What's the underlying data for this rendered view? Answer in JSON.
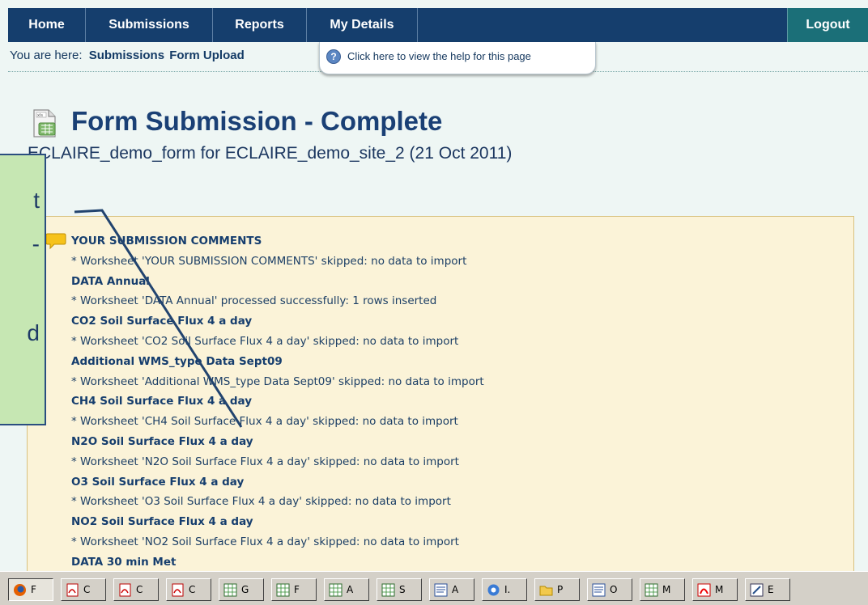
{
  "nav": {
    "items": [
      {
        "label": "Home"
      },
      {
        "label": "Submissions"
      },
      {
        "label": "Reports"
      },
      {
        "label": "My Details"
      }
    ],
    "logout": "Logout"
  },
  "breadcrumb": {
    "prefix": "You are here:",
    "section": "Submissions",
    "page": "Form Upload"
  },
  "help": {
    "icon": "help-icon",
    "text": "Click here to view the help for this page"
  },
  "page": {
    "title_icon": "spreadsheet-file-icon",
    "title": "Form Submission - Complete",
    "subtitle": "ECLAIRE_demo_form for ECLAIRE_demo_site_2 (21 Oct 2011)"
  },
  "comments": {
    "icon": "comment-bubble-icon",
    "entries": [
      {
        "text": "YOUR SUBMISSION COMMENTS",
        "kind": "heading"
      },
      {
        "text": "* Worksheet 'YOUR SUBMISSION COMMENTS' skipped: no data to import",
        "kind": "message"
      },
      {
        "text": "DATA Annual",
        "kind": "heading"
      },
      {
        "text": "* Worksheet 'DATA Annual' processed successfully: 1 rows inserted",
        "kind": "message"
      },
      {
        "text": "CO2 Soil Surface Flux 4 a day",
        "kind": "heading"
      },
      {
        "text": "* Worksheet 'CO2 Soil Surface Flux 4 a day' skipped: no data to import",
        "kind": "message"
      },
      {
        "text": "Additional WMS_type Data Sept09",
        "kind": "heading"
      },
      {
        "text": "* Worksheet 'Additional WMS_type Data Sept09' skipped: no data to import",
        "kind": "message"
      },
      {
        "text": "CH4 Soil Surface Flux 4 a day",
        "kind": "heading"
      },
      {
        "text": "* Worksheet 'CH4 Soil Surface Flux 4 a day' skipped: no data to import",
        "kind": "message"
      },
      {
        "text": "N2O Soil Surface Flux 4 a day",
        "kind": "heading"
      },
      {
        "text": "* Worksheet 'N2O Soil Surface Flux 4 a day' skipped: no data to import",
        "kind": "message"
      },
      {
        "text": "O3 Soil Surface Flux 4 a day",
        "kind": "heading"
      },
      {
        "text": "* Worksheet 'O3 Soil Surface Flux 4 a day' skipped: no data to import",
        "kind": "message"
      },
      {
        "text": "NO2 Soil Surface Flux 4 a day",
        "kind": "heading"
      },
      {
        "text": "* Worksheet 'NO2 Soil Surface Flux 4 a day' skipped: no data to import",
        "kind": "message"
      },
      {
        "text": "DATA 30 min Met",
        "kind": "heading"
      }
    ]
  },
  "callout": {
    "lines": [
      "t",
      "-",
      "d"
    ]
  },
  "taskbar": {
    "buttons": [
      {
        "label": "F",
        "icon": "firefox-icon"
      },
      {
        "label": "C",
        "icon": "pdf-icon"
      },
      {
        "label": "C",
        "icon": "pdf-icon"
      },
      {
        "label": "C",
        "icon": "pdf-icon"
      },
      {
        "label": "G",
        "icon": "excel-icon"
      },
      {
        "label": "F",
        "icon": "excel-icon"
      },
      {
        "label": "A",
        "icon": "excel-icon"
      },
      {
        "label": "S",
        "icon": "excel-icon"
      },
      {
        "label": "A",
        "icon": "word-icon"
      },
      {
        "label": "I.",
        "icon": "internet-explorer-icon"
      },
      {
        "label": "P",
        "icon": "folder-icon"
      },
      {
        "label": "O",
        "icon": "word-icon"
      },
      {
        "label": "M",
        "icon": "excel-icon"
      },
      {
        "label": "M",
        "icon": "acrobat-icon"
      },
      {
        "label": "E",
        "icon": "editor-icon"
      }
    ]
  },
  "colors": {
    "nav_bg": "#153e6d",
    "logout_bg": "#1b6f78",
    "page_bg": "#eef6f4",
    "panel_bg": "#fbf3d8",
    "title": "#1a4075",
    "callout_bg": "#c6e7b3"
  }
}
